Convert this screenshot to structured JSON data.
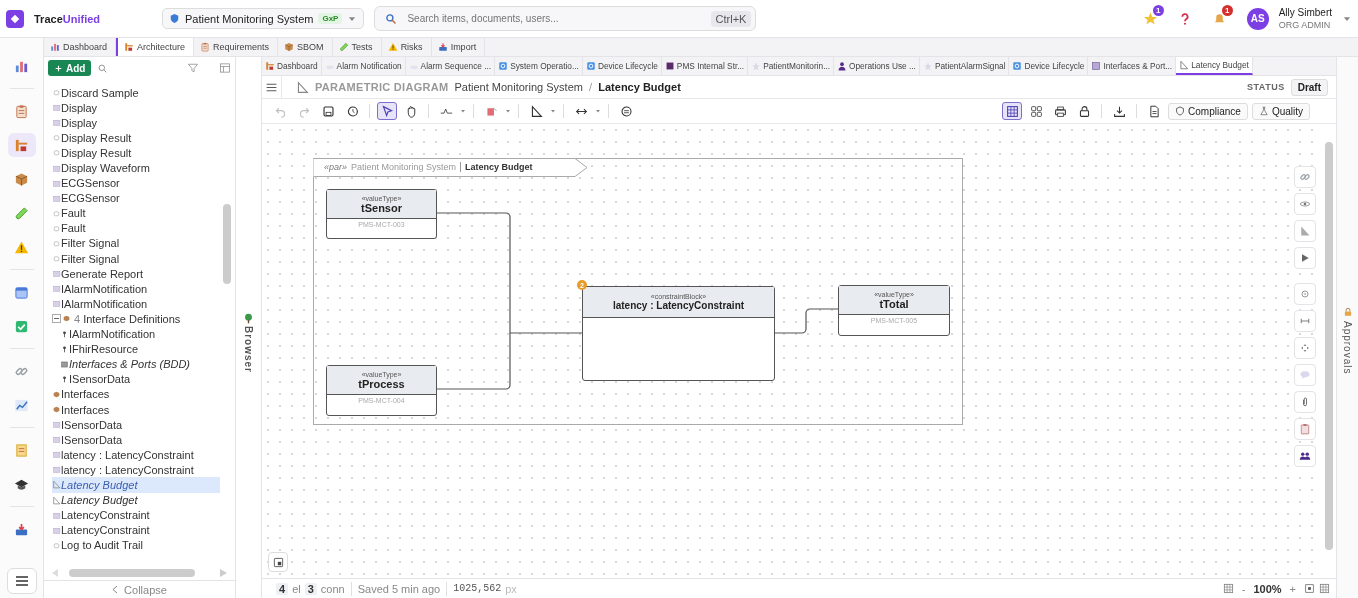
{
  "app": {
    "brand": [
      "Trace",
      "Unified"
    ]
  },
  "project": {
    "name": "Patient Monitoring System",
    "badge": "GxP"
  },
  "search": {
    "placeholder": "Search items, documents, users...",
    "shortcut": "Ctrl+K"
  },
  "favorites_badge": "1",
  "notifications_badge": "1",
  "user": {
    "initials": "AS",
    "name": "Ally Simbert",
    "role": "ORG ADMIN"
  },
  "rail": [
    {
      "selected": false
    },
    {
      "selected": false
    },
    {
      "selected": true
    },
    {
      "selected": false
    },
    {
      "selected": false
    },
    {
      "selected": false
    },
    {
      "selected": false
    },
    {
      "selected": false
    },
    {
      "selected": false
    },
    {
      "selected": false
    },
    {
      "selected": false
    },
    {
      "selected": false
    },
    {
      "selected": false
    }
  ],
  "module_tabs": [
    {
      "label": "Dashboard",
      "selected": false
    },
    {
      "label": "Architecture",
      "selected": true
    },
    {
      "label": "Requirements",
      "selected": false
    },
    {
      "label": "SBOM",
      "selected": false
    },
    {
      "label": "Tests",
      "selected": false
    },
    {
      "label": "Risks",
      "selected": false
    },
    {
      "label": "Import",
      "selected": false
    }
  ],
  "sidebar": {
    "add_label": "Add",
    "panel_label": "Browser",
    "collapse_label": "Collapse",
    "tree": [
      {
        "label": "Discard Sample",
        "kind": "action",
        "selected": false
      },
      {
        "label": "Display",
        "kind": "block",
        "selected": false
      },
      {
        "label": "Display",
        "kind": "block",
        "selected": false
      },
      {
        "label": "Display Result",
        "kind": "action",
        "selected": false
      },
      {
        "label": "Display Result",
        "kind": "action",
        "selected": false
      },
      {
        "label": "Display Waveform",
        "kind": "block",
        "selected": false
      },
      {
        "label": "ECGSensor",
        "kind": "block",
        "selected": false
      },
      {
        "label": "ECGSensor",
        "kind": "block",
        "selected": false
      },
      {
        "label": "Fault",
        "kind": "action",
        "selected": false
      },
      {
        "label": "Fault",
        "kind": "action",
        "selected": false
      },
      {
        "label": "Filter Signal",
        "kind": "action",
        "selected": false
      },
      {
        "label": "Filter Signal",
        "kind": "action",
        "selected": false
      },
      {
        "label": "Generate Report",
        "kind": "block",
        "selected": false
      },
      {
        "label": "IAlarmNotification",
        "kind": "block",
        "selected": false
      },
      {
        "label": "IAlarmNotification",
        "kind": "block",
        "selected": false
      },
      {
        "label": "Interface Definitions",
        "kind": "package",
        "count": "4",
        "expanded": true,
        "selected": false,
        "children": [
          {
            "label": "IAlarmNotification",
            "kind": "interface",
            "selected": false
          },
          {
            "label": "IFhirResource",
            "kind": "interface",
            "selected": false
          },
          {
            "label": "Interfaces & Ports (BDD)",
            "kind": "bdd",
            "selected": false
          },
          {
            "label": "ISensorData",
            "kind": "interface",
            "selected": false
          }
        ]
      },
      {
        "label": "Interfaces",
        "kind": "package",
        "selected": false
      },
      {
        "label": "Interfaces",
        "kind": "package",
        "selected": false
      },
      {
        "label": "ISensorData",
        "kind": "block",
        "selected": false
      },
      {
        "label": "ISensorData",
        "kind": "block",
        "selected": false
      },
      {
        "label": "latency : LatencyConstraint",
        "kind": "block",
        "selected": false
      },
      {
        "label": "latency : LatencyConstraint",
        "kind": "block",
        "selected": false
      },
      {
        "label": "Latency Budget",
        "kind": "diagram",
        "selected": true
      },
      {
        "label": "Latency Budget",
        "kind": "diagram",
        "selected": false
      },
      {
        "label": "LatencyConstraint",
        "kind": "block",
        "selected": false
      },
      {
        "label": "LatencyConstraint",
        "kind": "block",
        "selected": false
      },
      {
        "label": "Log to Audit Trail",
        "kind": "action",
        "selected": false
      }
    ]
  },
  "doc_tabs": [
    {
      "label": "Dashboard",
      "selected": false
    },
    {
      "label": "Alarm Notification",
      "selected": false
    },
    {
      "label": "Alarm Sequence ...",
      "selected": false
    },
    {
      "label": "System Operatio...",
      "selected": false
    },
    {
      "label": "Device Lifecycle",
      "selected": false
    },
    {
      "label": "PMS Internal Str...",
      "selected": false
    },
    {
      "label": "PatientMonitorin...",
      "selected": false
    },
    {
      "label": "Operations Use ...",
      "selected": false
    },
    {
      "label": "PatientAlarmSignal",
      "selected": false
    },
    {
      "label": "Device Lifecycle",
      "selected": false
    },
    {
      "label": "Interfaces & Port...",
      "selected": false
    },
    {
      "label": "Latency Budget",
      "selected": true
    }
  ],
  "breadcrumb": {
    "type": "PARAMETRIC DIAGRAM",
    "parent": "Patient Monitoring System",
    "separator": "/",
    "current": "Latency Budget"
  },
  "status": {
    "label": "STATUS",
    "value": "Draft"
  },
  "toolbar": {
    "tools": [
      {
        "selected": false,
        "disabled": true
      },
      {
        "selected": false,
        "disabled": true
      },
      {
        "selected": false,
        "disabled": false
      },
      {
        "selected": false,
        "disabled": false
      },
      {
        "selected": true,
        "disabled": false
      },
      {
        "selected": false,
        "disabled": false
      },
      {
        "selected": false,
        "disabled": false
      },
      {
        "selected": false,
        "disabled": false
      },
      {
        "selected": false,
        "disabled": false
      },
      {
        "selected": false,
        "disabled": false
      },
      {
        "selected": false,
        "disabled": false
      }
    ],
    "views": [
      {
        "selected": true
      },
      {
        "selected": false
      }
    ],
    "actions": [
      "Compliance",
      "Quality"
    ]
  },
  "diagram": {
    "frame": {
      "stereotype": "«par»",
      "context": "Patient Monitoring System",
      "title": "Latency Budget"
    },
    "blocks": [
      {
        "kind": "valueType",
        "stereotype": "«valueType»",
        "name": "tSensor",
        "id": "PMS-MCT-003"
      },
      {
        "kind": "valueType",
        "stereotype": "«valueType»",
        "name": "tProcess",
        "id": "PMS-MCT-004"
      },
      {
        "kind": "constraint",
        "stereotype": "«constraintBlock»",
        "name": "latency : LatencyConstraint",
        "badge": "2"
      },
      {
        "kind": "valueType",
        "stereotype": "«valueType»",
        "name": "tTotal",
        "id": "PMS-MCT-005"
      }
    ]
  },
  "approvals_label": "Approvals",
  "footer": {
    "elements": "4",
    "elements_unit": "el",
    "connectors": "3",
    "connectors_unit": "conn",
    "saved": "Saved 5 min ago",
    "cursor": "1025,562",
    "cursor_unit": "px",
    "zoom_out": "-",
    "zoom": "100%",
    "zoom_in": "+"
  }
}
